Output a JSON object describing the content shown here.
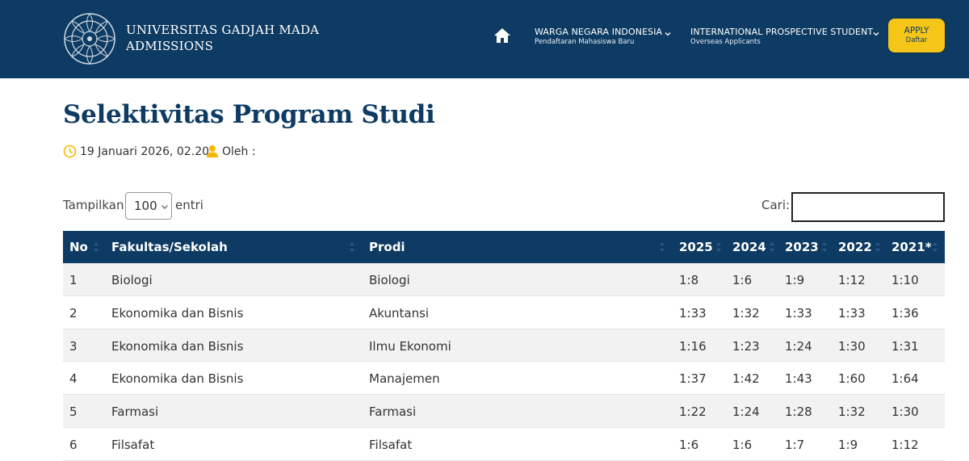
{
  "header": {
    "brand_line1": "UNIVERSITAS GADJAH MADA",
    "brand_line2": "ADMISSIONS",
    "nav": [
      {
        "main": "WARGA NEGARA INDONESIA",
        "sub": "Pendaftaran Mahasiswa Baru"
      },
      {
        "main": "INTERNATIONAL PROSPECTIVE STUDENT",
        "sub": "Overseas Applicants"
      }
    ],
    "apply": {
      "label": "APPLY",
      "sub": "Daftar"
    },
    "icons": {
      "home": "home-icon",
      "logo": "ugm-seal-logo",
      "chevron": "chevron-down-icon"
    },
    "colors": {
      "navy": "#0e3b63",
      "accent": "#f5c518"
    }
  },
  "page": {
    "title": "Selektivitas Program Studi",
    "date": "19 Januari 2026, 02.20",
    "author_label": "Oleh :"
  },
  "controls": {
    "show_label": "Tampilkan",
    "show_value": "100",
    "entries_label": "entri",
    "search_label": "Cari:",
    "search_value": ""
  },
  "table": {
    "headers": [
      "No",
      "Fakultas/Sekolah",
      "Prodi",
      "2025",
      "2024",
      "2023",
      "2022",
      "2021*"
    ],
    "rows": [
      [
        "1",
        "Biologi",
        "Biologi",
        "1:8",
        "1:6",
        "1:9",
        "1:12",
        "1:10"
      ],
      [
        "2",
        "Ekonomika dan Bisnis",
        "Akuntansi",
        "1:33",
        "1:32",
        "1:33",
        "1:33",
        "1:36"
      ],
      [
        "3",
        "Ekonomika dan Bisnis",
        "Ilmu Ekonomi",
        "1:16",
        "1:23",
        "1:24",
        "1:30",
        "1:31"
      ],
      [
        "4",
        "Ekonomika dan Bisnis",
        "Manajemen",
        "1:37",
        "1:42",
        "1:43",
        "1:60",
        "1:64"
      ],
      [
        "5",
        "Farmasi",
        "Farmasi",
        "1:22",
        "1:24",
        "1:28",
        "1:32",
        "1:30"
      ],
      [
        "6",
        "Filsafat",
        "Filsafat",
        "1:6",
        "1:6",
        "1:7",
        "1:9",
        "1:12"
      ]
    ]
  }
}
